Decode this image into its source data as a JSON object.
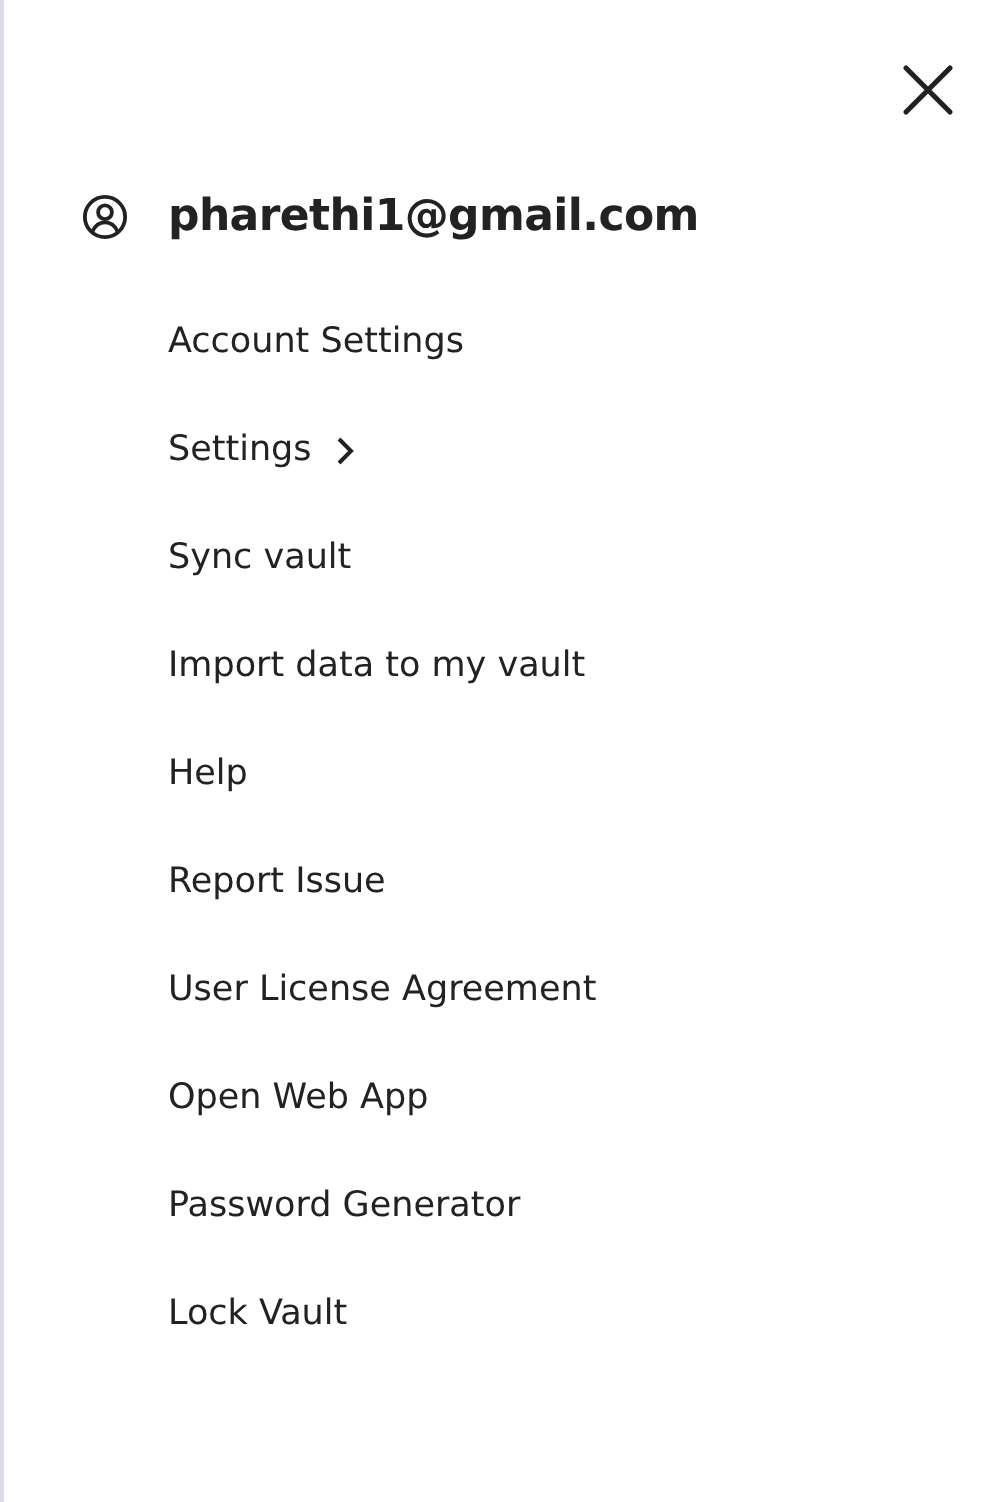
{
  "account": {
    "email": "pharethi1@gmail.com"
  },
  "menu_items": [
    {
      "label": "Account Settings",
      "kind": "link"
    },
    {
      "label": "Settings",
      "kind": "submenu"
    },
    {
      "label": "Sync vault",
      "kind": "link"
    },
    {
      "label": "Import data to my vault",
      "kind": "link"
    },
    {
      "label": "Help",
      "kind": "link"
    },
    {
      "label": "Report Issue",
      "kind": "link"
    },
    {
      "label": "User License Agreement",
      "kind": "link"
    },
    {
      "label": "Open Web App",
      "kind": "link"
    },
    {
      "label": "Password Generator",
      "kind": "link"
    },
    {
      "label": "Lock Vault",
      "kind": "link"
    }
  ]
}
